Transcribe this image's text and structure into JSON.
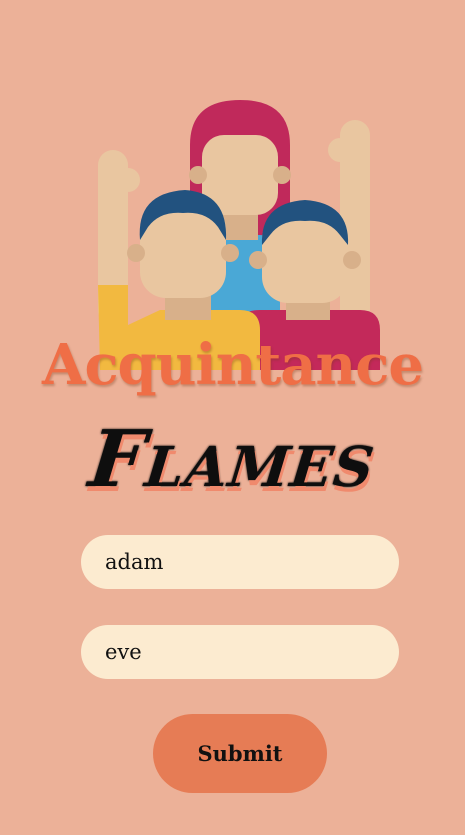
{
  "hero": {
    "icon": "group-of-people-illustration"
  },
  "subtitle": "Acquintance",
  "title": "Flames",
  "form": {
    "name1_value": "adam",
    "name2_value": "eve",
    "submit_label": "Submit"
  },
  "colors": {
    "background": "#ecb198",
    "accent": "#ef6e46",
    "field_background": "#fcebd0",
    "button": "#e67c55"
  }
}
